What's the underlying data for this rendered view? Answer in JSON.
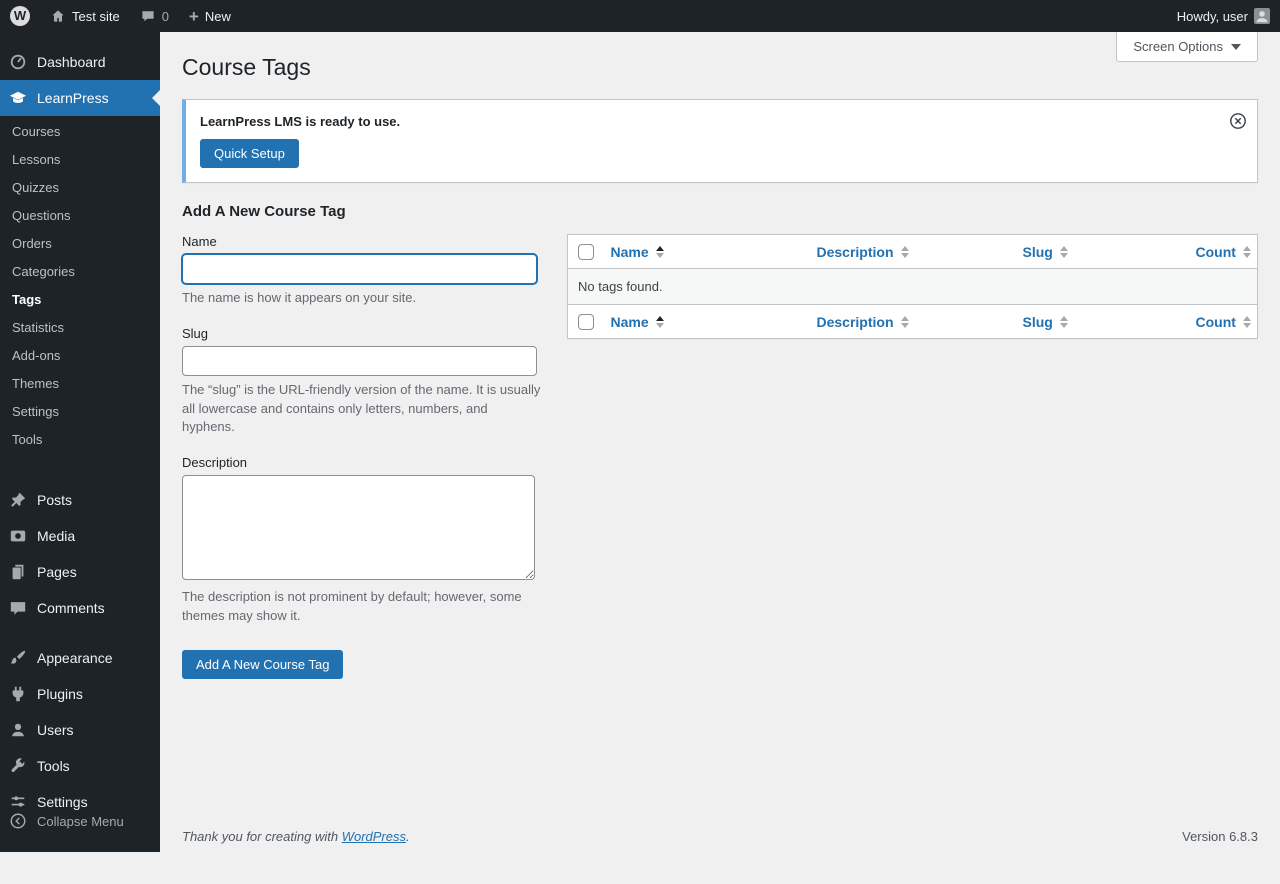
{
  "admin_bar": {
    "site_name": "Test site",
    "comments_count": "0",
    "new_label": "New",
    "howdy_text": "Howdy, user"
  },
  "sidebar": {
    "items": [
      {
        "label": "Dashboard"
      },
      {
        "label": "LearnPress"
      },
      {
        "label": "Posts"
      },
      {
        "label": "Media"
      },
      {
        "label": "Pages"
      },
      {
        "label": "Comments"
      },
      {
        "label": "Appearance"
      },
      {
        "label": "Plugins"
      },
      {
        "label": "Users"
      },
      {
        "label": "Tools"
      },
      {
        "label": "Settings"
      }
    ],
    "learnpress_submenu": [
      {
        "label": "Courses"
      },
      {
        "label": "Lessons"
      },
      {
        "label": "Quizzes"
      },
      {
        "label": "Questions"
      },
      {
        "label": "Orders"
      },
      {
        "label": "Categories"
      },
      {
        "label": "Tags"
      },
      {
        "label": "Statistics"
      },
      {
        "label": "Add-ons"
      },
      {
        "label": "Themes"
      },
      {
        "label": "Settings"
      },
      {
        "label": "Tools"
      }
    ],
    "collapse_label": "Collapse Menu"
  },
  "page": {
    "title": "Course Tags",
    "screen_options_label": "Screen Options",
    "notice": {
      "message": "LearnPress LMS is ready to use.",
      "button_label": "Quick Setup"
    },
    "form": {
      "heading": "Add A New Course Tag",
      "name_label": "Name",
      "name_help": "The name is how it appears on your site.",
      "slug_label": "Slug",
      "slug_help": "The “slug” is the URL-friendly version of the name. It is usually all lowercase and contains only letters, numbers, and hyphens.",
      "description_label": "Description",
      "description_help": "The description is not prominent by default; however, some themes may show it.",
      "submit_label": "Add A New Course Tag"
    },
    "table": {
      "columns": [
        "Name",
        "Description",
        "Slug",
        "Count"
      ],
      "empty_message": "No tags found."
    }
  },
  "footer": {
    "thanks_prefix": "Thank you for creating with ",
    "wordpress_link": "WordPress",
    "thanks_suffix": ".",
    "version": "Version 6.8.3"
  },
  "colors": {
    "accent": "#2271b1",
    "admin_bar_bg": "#1d2327",
    "notice_border": "#72aee6"
  }
}
